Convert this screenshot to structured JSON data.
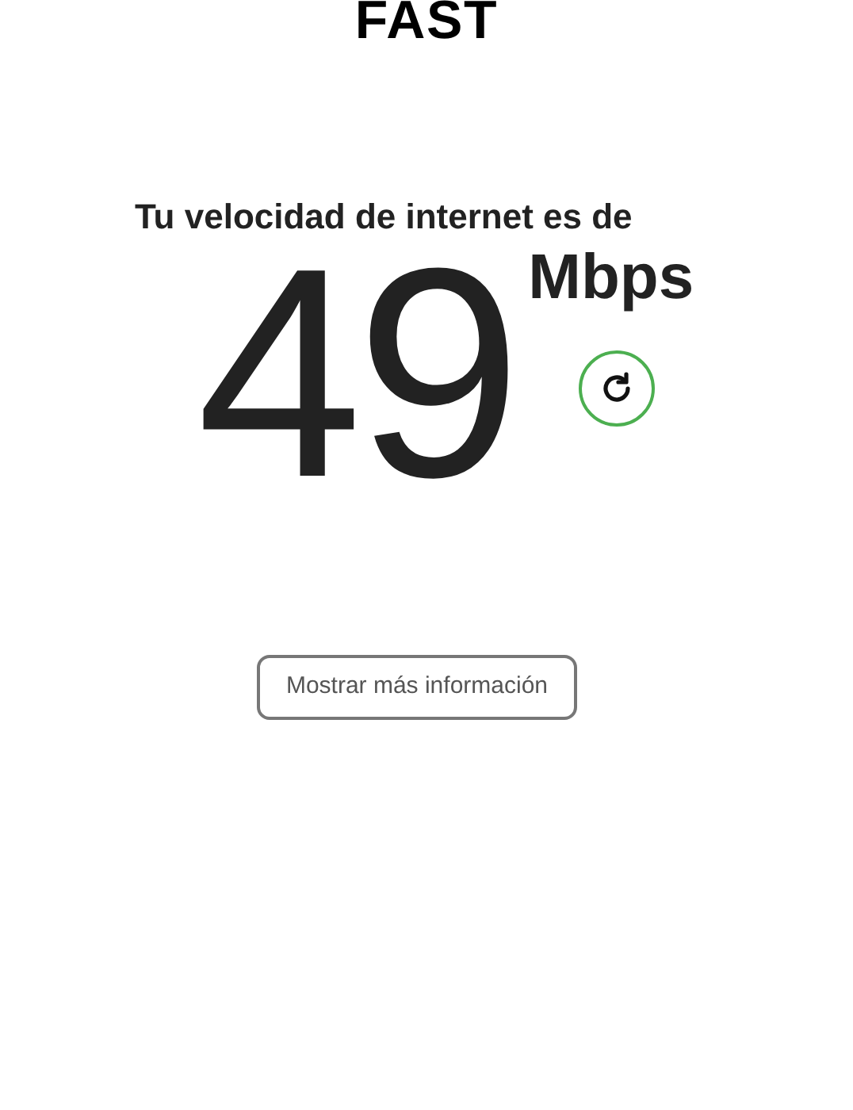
{
  "logo": "FAST",
  "heading": "Tu velocidad de internet es de",
  "speed": {
    "value": "49",
    "unit": "Mbps"
  },
  "more_info_button": "Mostrar más información"
}
